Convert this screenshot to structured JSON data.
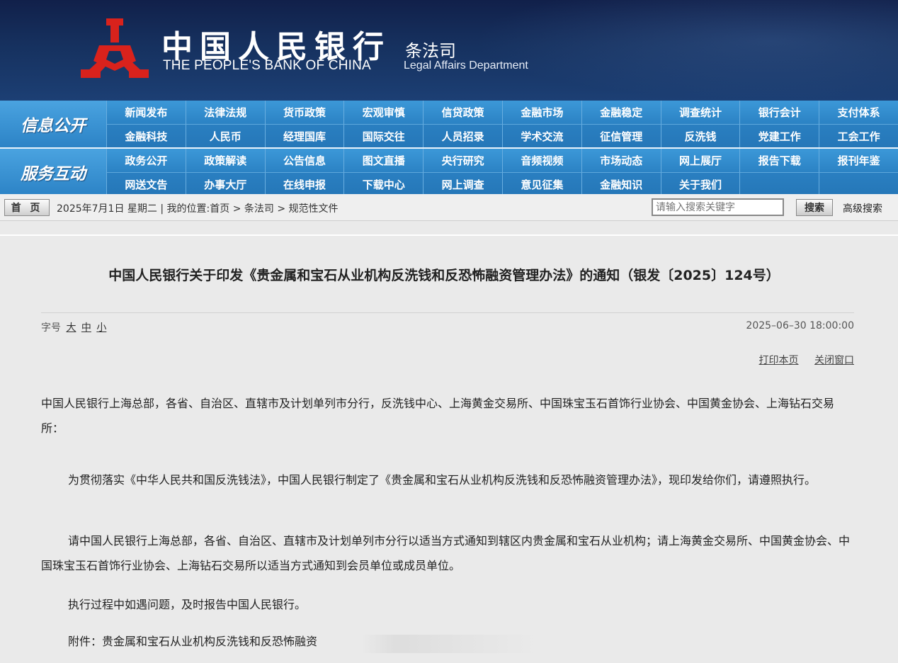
{
  "header": {
    "bank_name_cn": "中国人民银行",
    "bank_name_en": "THE PEOPLE'S BANK OF CHINA",
    "department_cn": "条法司",
    "department_en": "Legal Affairs Department",
    "logo_icon": "pboc-logo-icon",
    "logo_color": "#d9221c"
  },
  "nav": {
    "section1_title": "信息公开",
    "section1_items": [
      "新闻发布",
      "法律法规",
      "货币政策",
      "宏观审慎",
      "信贷政策",
      "金融市场",
      "金融稳定",
      "调查统计",
      "银行会计",
      "支付体系",
      "金融科技",
      "人民币",
      "经理国库",
      "国际交往",
      "人员招录",
      "学术交流",
      "征信管理",
      "反洗钱",
      "党建工作",
      "工会工作"
    ],
    "section2_title": "服务互动",
    "section2_items": [
      "政务公开",
      "政策解读",
      "公告信息",
      "图文直播",
      "央行研究",
      "音频视频",
      "市场动态",
      "网上展厅",
      "报告下载",
      "报刊年鉴",
      "网送文告",
      "办事大厅",
      "在线申报",
      "下载中心",
      "网上调查",
      "意见征集",
      "金融知识",
      "关于我们",
      "",
      ""
    ]
  },
  "crumb": {
    "home_label": "首 页",
    "date_text": "2025年7月1日 星期二",
    "location_text": "我的位置:首页 > 条法司 > 规范性文件",
    "search_placeholder": "请输入搜索关键字",
    "search_label": "搜索",
    "advanced_label": "高级搜索"
  },
  "article": {
    "title": "中国人民银行关于印发《贵金属和宝石从业机构反洗钱和反恐怖融资管理办法》的通知（银发〔2025〕124号）",
    "font_size_label": "字号",
    "font_large": "大",
    "font_medium": "中",
    "font_small": "小",
    "date": "2025–06–30 18:00:00",
    "print_label": "打印本页",
    "close_label": "关闭窗口",
    "addressee": "中国人民银行上海总部，各省、自治区、直辖市及计划单列市分行，反洗钱中心、上海黄金交易所、中国珠宝玉石首饰行业协会、中国黄金协会、上海钻石交易所：",
    "para1": "为贯彻落实《中华人民共和国反洗钱法》，中国人民银行制定了《贵金属和宝石从业机构反洗钱和反恐怖融资管理办法》，现印发给你们，请遵照执行。",
    "para2": "请中国人民银行上海总部，各省、自治区、直辖市及计划单列市分行以适当方式通知到辖区内贵金属和宝石从业机构；请上海黄金交易所、中国黄金协会、中国珠宝玉石首饰行业协会、上海钻石交易所以适当方式通知到会员单位或成员单位。",
    "para3": "执行过程中如遇问题，及时报告中国人民银行。",
    "attachment": "附件：贵金属和宝石从业机构反洗钱和反恐怖融资"
  }
}
